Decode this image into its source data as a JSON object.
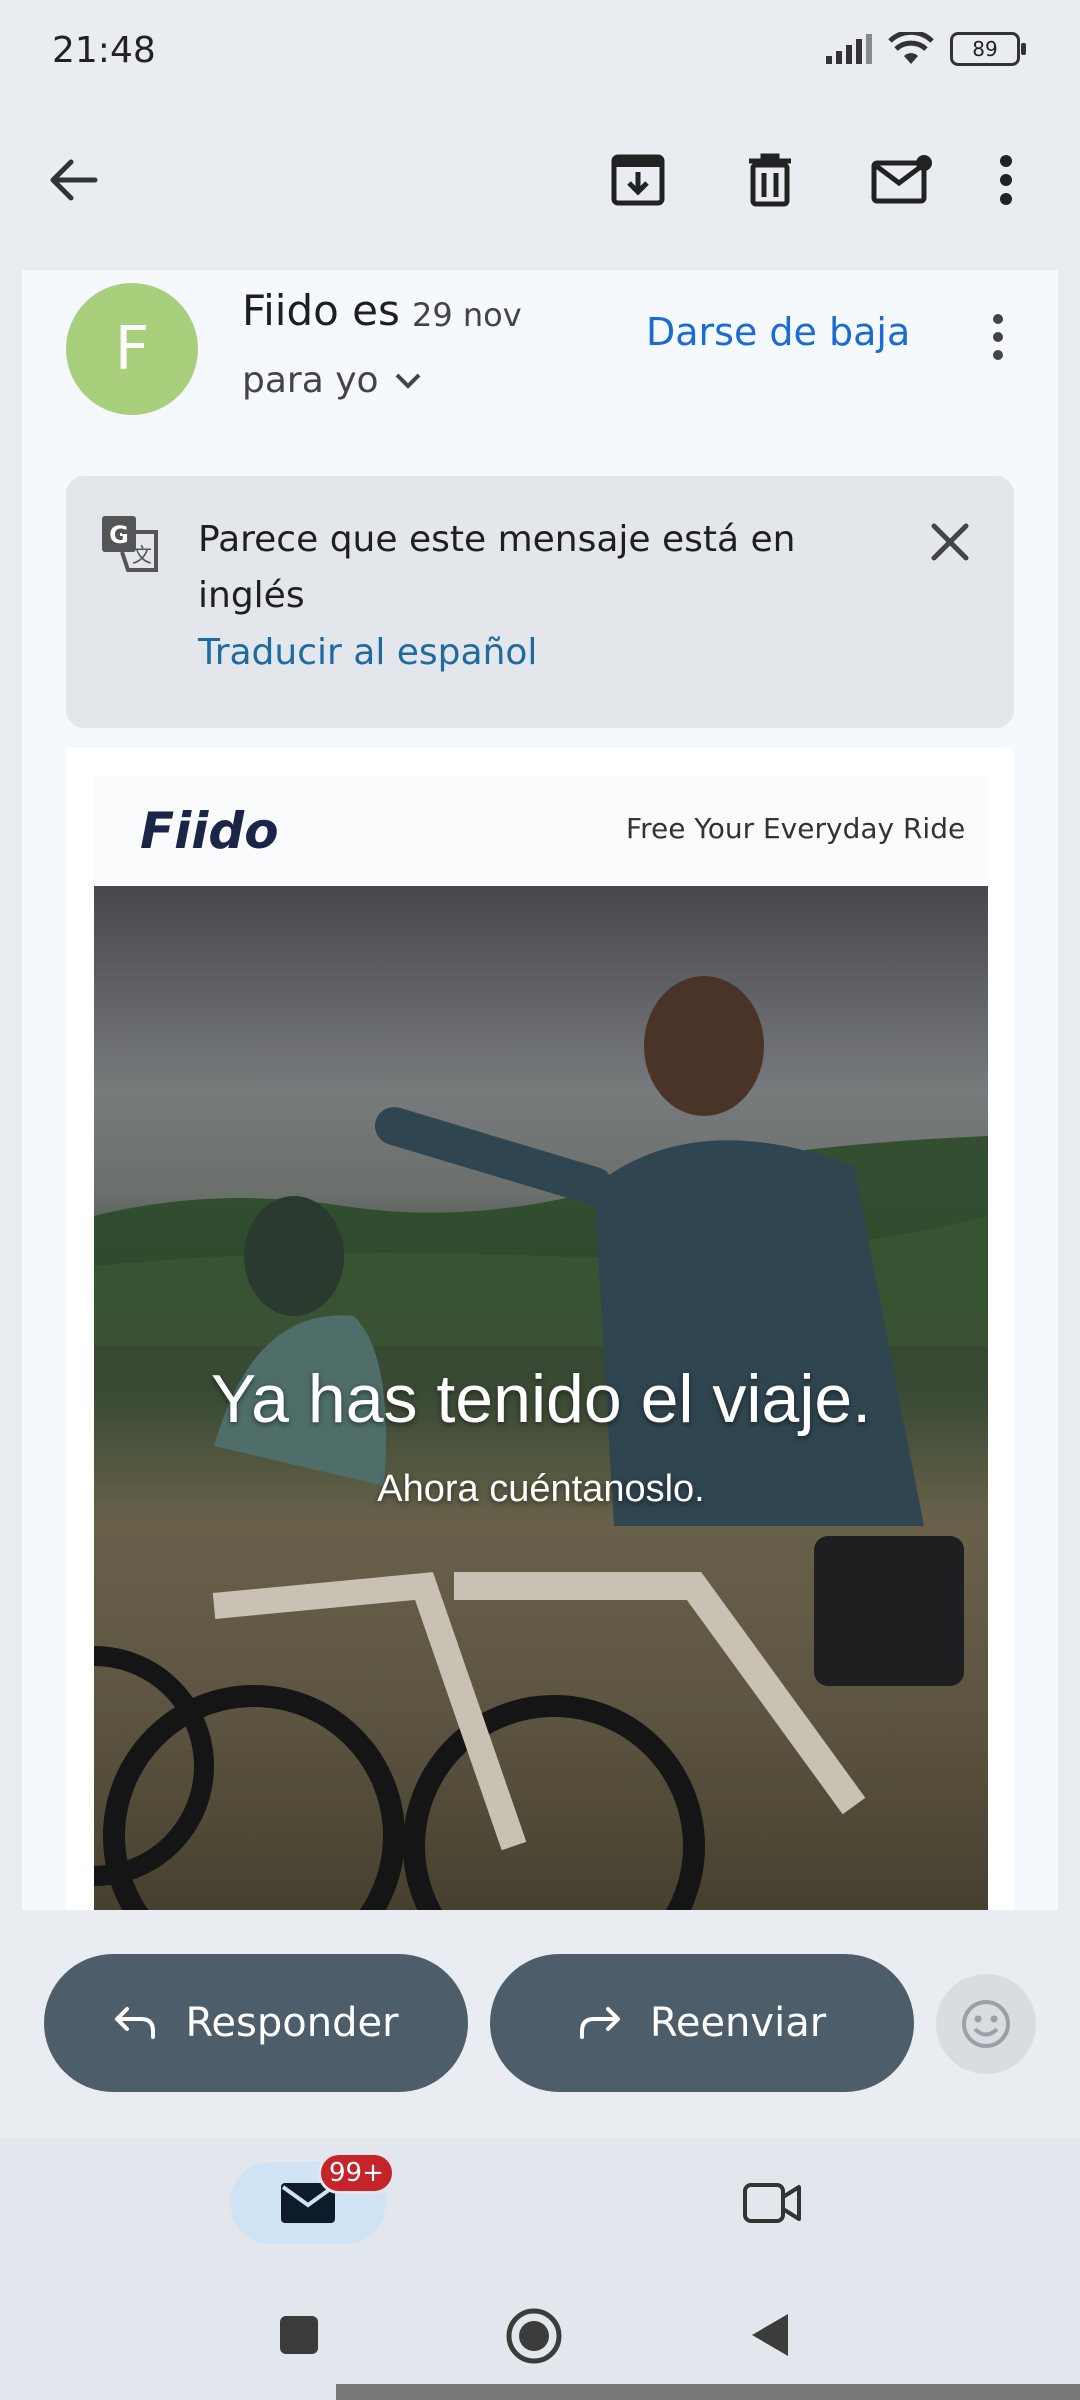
{
  "status_bar": {
    "time": "21:48",
    "battery": "89"
  },
  "toolbar": {
    "back_icon": "arrow-left-icon",
    "archive_icon": "archive-icon",
    "delete_icon": "trash-icon",
    "mark_unread_icon": "mail-unread-icon",
    "more_icon": "more-vert-icon"
  },
  "email": {
    "avatar_letter": "F",
    "avatar_color": "#a7cf7c",
    "sender": "Fiido es",
    "date": "29 nov",
    "to": "para yo",
    "unsubscribe": "Darse de baja"
  },
  "translate": {
    "message": "Parece que este mensaje está en inglés",
    "link": "Traducir al español"
  },
  "body": {
    "brand": "Fiido",
    "tagline": "Free Your Everyday Ride",
    "hero_title": "Ya has tenido el viaje.",
    "hero_subtitle": "Ahora cuéntanoslo."
  },
  "actions": {
    "reply": "Responder",
    "forward": "Reenviar"
  },
  "bottom_nav": {
    "mail_badge": "99+"
  },
  "colors": {
    "accent": "#1a6cd3",
    "pill": "#4d5d69",
    "badge": "#c4242a"
  }
}
